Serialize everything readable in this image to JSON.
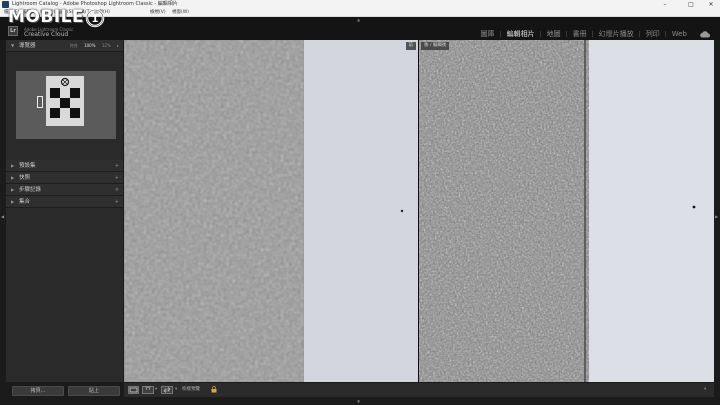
{
  "window": {
    "title": "Lightroom Catalog - Adobe Photoshop Lightroom Classic - 編輯相片",
    "controls": {
      "minimize": "–",
      "maximize": "□",
      "close": "✕"
    }
  },
  "menu": {
    "items": [
      "檔案(F)",
      "編輯(E)",
      "相片(P)",
      "設定(S)",
      "工具(T)",
      "檢視(V)",
      "視窗(W)",
      "說明(H)"
    ]
  },
  "watermark": {
    "text": "MOBILE"
  },
  "identity": {
    "badge": "Lr",
    "line1": "Adobe Lightroom Classic",
    "line2": "Creative Cloud"
  },
  "modules": {
    "items": [
      {
        "label": "圖庫",
        "active": false
      },
      {
        "label": "編輯相片",
        "active": true
      },
      {
        "label": "地圖",
        "active": false
      },
      {
        "label": "書冊",
        "active": false
      },
      {
        "label": "幻燈片播放",
        "active": false
      },
      {
        "label": "列印",
        "active": false
      },
      {
        "label": "Web",
        "active": false
      }
    ]
  },
  "left_panel": {
    "navigator": {
      "title": "導覽器",
      "zoom": {
        "fit": "符合",
        "z100": "100%",
        "z125": "12%"
      }
    },
    "sections": [
      {
        "title": "預設集"
      },
      {
        "title": "快照"
      },
      {
        "title": "步驟記錄"
      },
      {
        "title": "集合"
      }
    ],
    "buttons": {
      "copy": "拷貝...",
      "paste": "貼上"
    }
  },
  "viewer": {
    "before_label": "前",
    "after_label": "後 / 編輯後"
  },
  "toolbar": {
    "view_mode": "YY",
    "before_after": "前/後",
    "soft_proof": "校樣預覽"
  },
  "colors": {
    "concrete": "#8a8a8a",
    "paper": "#d3d6df",
    "panel": "#2a2a2a",
    "background": "#1b1b1b"
  }
}
